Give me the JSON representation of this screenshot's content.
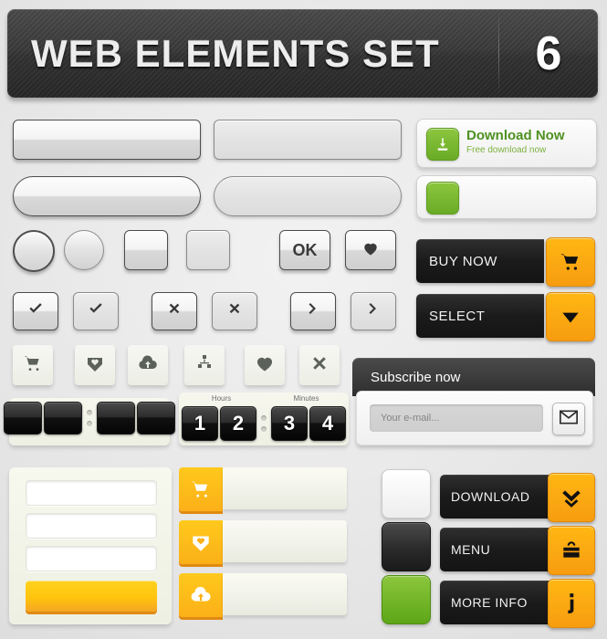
{
  "header": {
    "title": "WEB ELEMENTS SET",
    "number": "6"
  },
  "colors": {
    "orange": "#f7a50f",
    "green": "#6aab26",
    "yellow": "#ffc40d",
    "dark": "#1b1b1b"
  },
  "blank_buttons": [
    {
      "name": "rect-glossy",
      "label": ""
    },
    {
      "name": "rect-matte",
      "label": ""
    },
    {
      "name": "pill-glossy",
      "label": ""
    },
    {
      "name": "pill-matte",
      "label": ""
    }
  ],
  "controls": {
    "radio_glossy": "",
    "radio_matte": "",
    "square_glossy": "",
    "square_matte": "",
    "ok_label": "OK",
    "heart_icon": "heart-icon",
    "check_icon": "check-icon",
    "close_icon": "close-icon",
    "arrow_icon": "chevron-right-icon"
  },
  "icon_tiles": [
    {
      "name": "cart-icon"
    },
    {
      "name": "heart-download-icon"
    },
    {
      "name": "cloud-upload-icon"
    },
    {
      "name": "sitemap-icon"
    },
    {
      "name": "heart-icon"
    },
    {
      "name": "close-icon"
    }
  ],
  "clock_blank": {
    "digits": [
      "",
      "",
      "",
      ""
    ]
  },
  "clock_time": {
    "hours_label": "Hours",
    "minutes_label": "Minutes",
    "hours": [
      "1",
      "2"
    ],
    "minutes": [
      "3",
      "4"
    ]
  },
  "form": {
    "field1": "",
    "field2": "",
    "field3": "",
    "submit_label": ""
  },
  "orange_bars": [
    {
      "icon": "cart-icon",
      "label": ""
    },
    {
      "icon": "heart-download-icon",
      "label": ""
    },
    {
      "icon": "cloud-upload-icon",
      "label": ""
    }
  ],
  "download": {
    "title": "Download Now",
    "subtitle": "Free download now",
    "icon": "download-icon",
    "empty_icon": "green-square-icon"
  },
  "cta": [
    {
      "label": "BUY NOW",
      "icon": "cart-icon"
    },
    {
      "label": "SELECT",
      "icon": "caret-down-icon"
    }
  ],
  "subscribe": {
    "header": "Subscribe now",
    "placeholder": "Your e-mail...",
    "value": "",
    "submit_icon": "envelope-icon"
  },
  "action_buttons": [
    {
      "label": "DOWNLOAD",
      "icon": "double-chevron-down-icon",
      "swatch": "white"
    },
    {
      "label": "MENU",
      "icon": "basket-icon",
      "swatch": "black"
    },
    {
      "label": "MORE INFO",
      "icon": "info-icon",
      "swatch": "green"
    }
  ]
}
